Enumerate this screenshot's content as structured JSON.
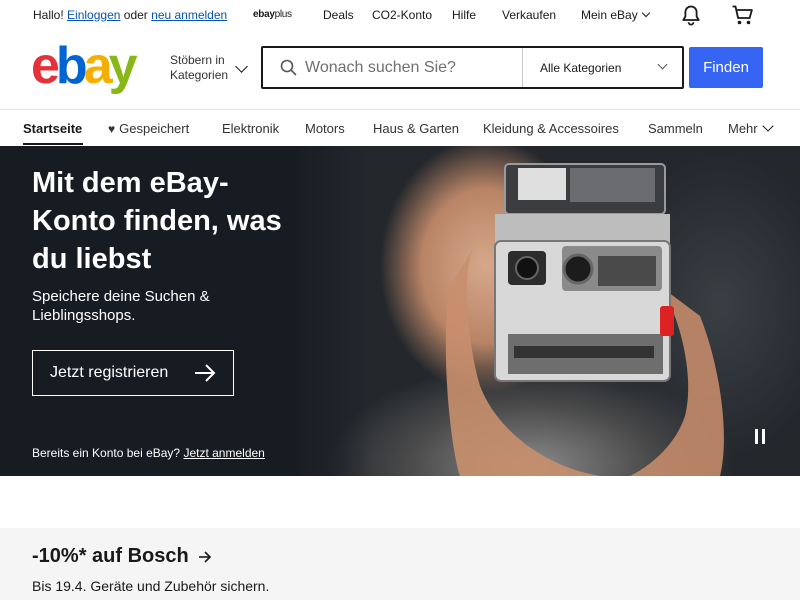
{
  "topbar": {
    "greeting": "Hallo!",
    "login_link": "Einloggen",
    "or_text": "oder",
    "register_link": "neu anmelden",
    "ebay_plus": {
      "brand": "ebay",
      "plus": "plus"
    },
    "links": [
      "Deals",
      "CO2-Konto",
      "Hilfe",
      "Verkaufen",
      "Mein eBay"
    ],
    "icons": [
      "bell-icon",
      "cart-icon"
    ]
  },
  "header": {
    "logo": {
      "e": "e",
      "b": "b",
      "a": "a",
      "y": "y"
    },
    "browse_line1": "Stöbern in",
    "browse_line2": "Kategorien",
    "search_placeholder": "Wonach suchen Sie?",
    "category_selected": "Alle Kategorien",
    "find_button": "Finden"
  },
  "nav": {
    "tabs": [
      "Startseite",
      "Gespeichert",
      "Elektronik",
      "Motors",
      "Haus & Garten",
      "Kleidung & Accessoires",
      "Sammeln",
      "Mehr"
    ]
  },
  "hero": {
    "title": "Mit dem eBay-Konto finden, was du liebst",
    "subtitle": "Speichere deine Suchen & Lieblingsshops.",
    "cta": "Jetzt registrieren",
    "login_prompt": "Bereits ein Konto bei eBay?",
    "login_link": "Jetzt anmelden"
  },
  "promo": {
    "title": "-10%* auf Bosch",
    "subtitle": "Bis 19.4. Geräte und Zubehör sichern."
  },
  "colors": {
    "accent": "#3665f3",
    "link": "#0654ba",
    "hero_bg": "#171b22",
    "promo_bg": "#f5f5f5"
  }
}
